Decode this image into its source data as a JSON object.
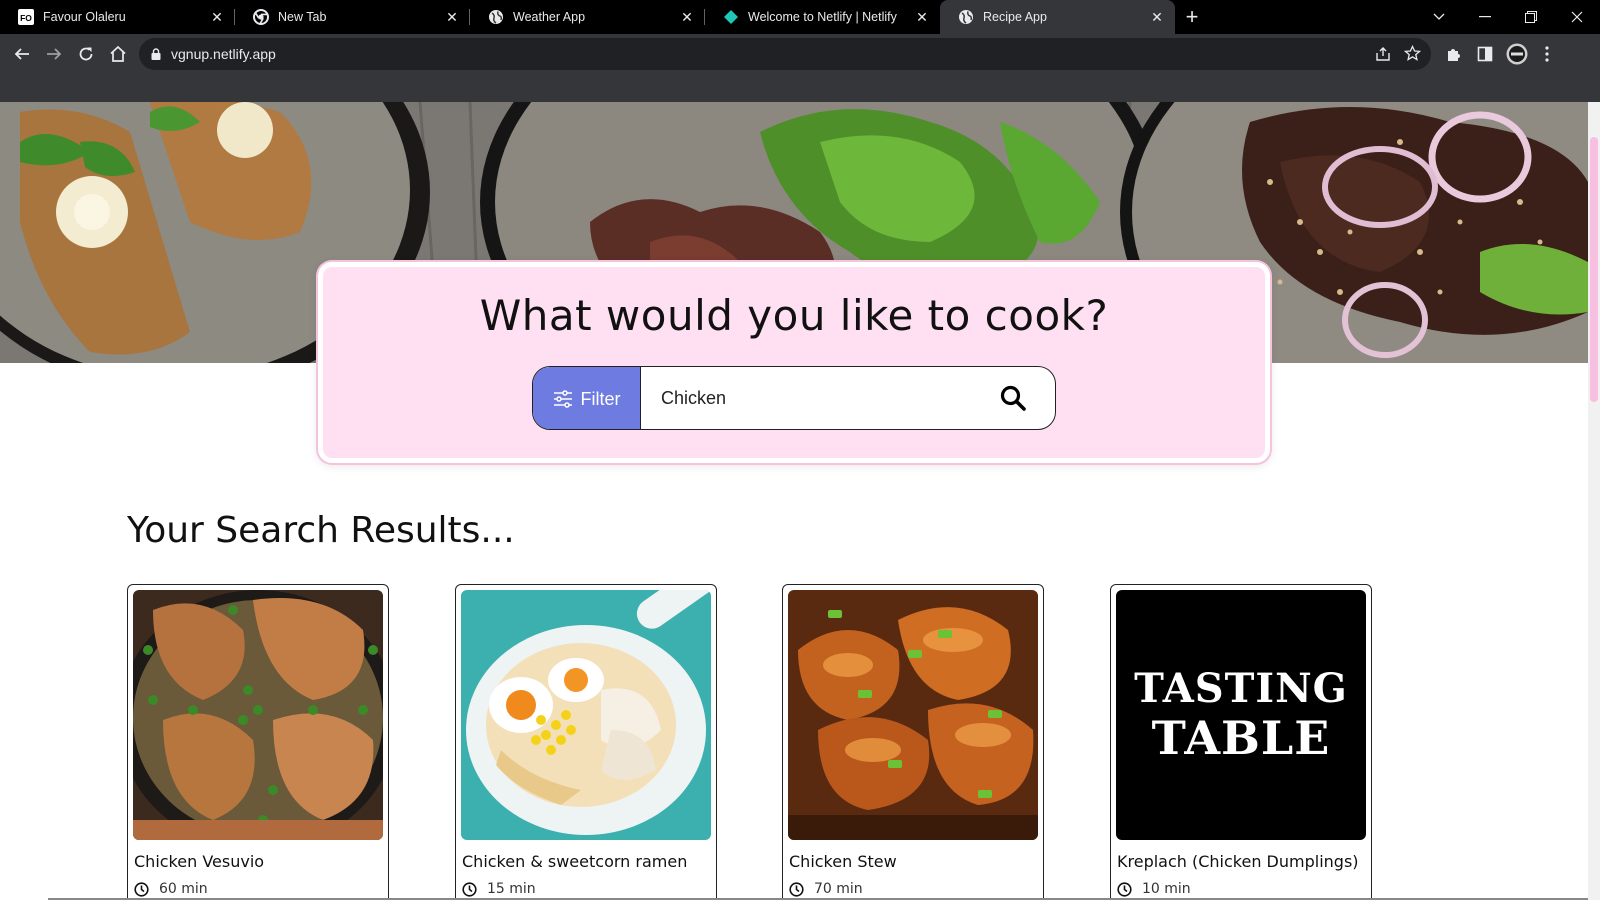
{
  "browser": {
    "tabs": [
      {
        "title": "Favour Olaleru",
        "favicon": "fo-monogram-icon",
        "active": false
      },
      {
        "title": "New Tab",
        "favicon": "chrome-icon",
        "active": false
      },
      {
        "title": "Weather App",
        "favicon": "globe-icon",
        "active": false
      },
      {
        "title": "Welcome to Netlify | Netlify",
        "favicon": "netlify-icon",
        "active": false
      },
      {
        "title": "Recipe App",
        "favicon": "globe-icon",
        "active": true
      }
    ],
    "favicon_text": "FO",
    "close_glyph": "✕",
    "new_tab_glyph": "+",
    "url": "vgnup.netlify.app"
  },
  "search": {
    "title": "What would you like to cook?",
    "filter_label": "Filter",
    "query": "Chicken"
  },
  "results": {
    "heading": "Your Search Results...",
    "items": [
      {
        "title": "Chicken Vesuvio",
        "time": "60 min"
      },
      {
        "title": "Chicken & sweetcorn ramen",
        "time": "15 min"
      },
      {
        "title": "Chicken Stew",
        "time": "70 min"
      },
      {
        "title": "Kreplach (Chicken Dumplings)",
        "time": "10 min",
        "logo_lines": [
          "TASTING",
          "TABLE"
        ]
      }
    ]
  },
  "colors": {
    "filter_button": "#6e7be0",
    "search_card": "#ffe0f3",
    "scroll_thumb": "#f7bfe0"
  }
}
